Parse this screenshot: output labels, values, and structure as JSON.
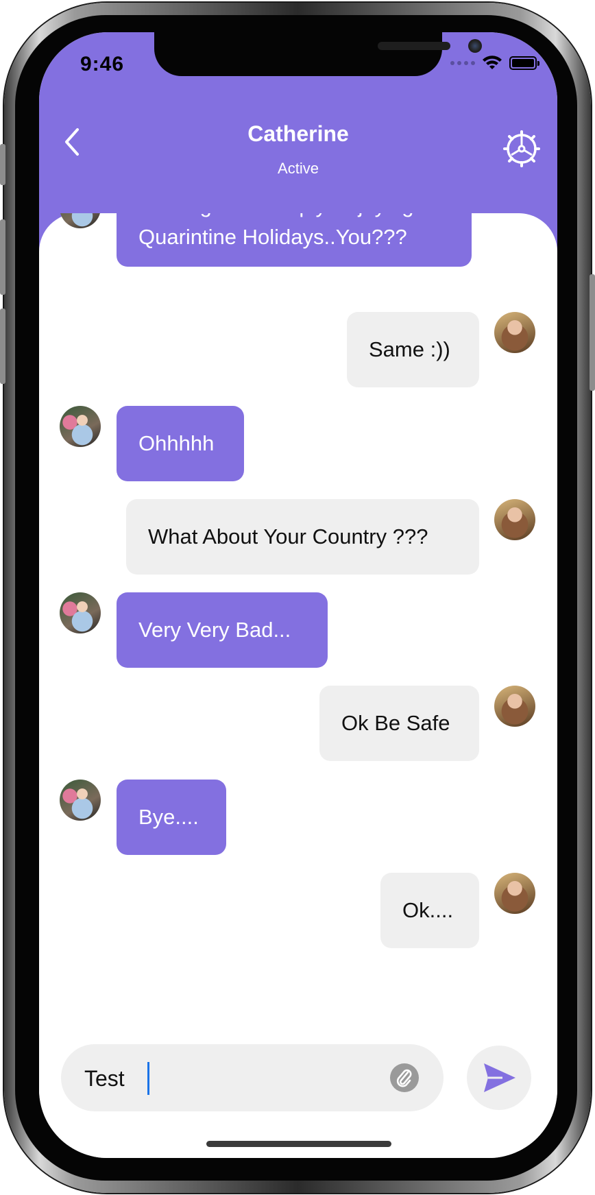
{
  "status_bar": {
    "time": "9:46"
  },
  "header": {
    "title": "Catherine",
    "subtitle": "Active"
  },
  "messages": [
    {
      "side": "in",
      "line1": "Nothing Just Simply Enjoying",
      "line2": "Quarintine Holidays..You???"
    },
    {
      "side": "out",
      "text": "Same :))"
    },
    {
      "side": "in",
      "text": "Ohhhhh"
    },
    {
      "side": "out",
      "text": "What About Your Country ???"
    },
    {
      "side": "in",
      "text": "Very Very Bad..."
    },
    {
      "side": "out",
      "text": "Ok Be Safe"
    },
    {
      "side": "in",
      "text": "Bye...."
    },
    {
      "side": "out",
      "text": "Ok...."
    }
  ],
  "composer": {
    "value": "Test"
  },
  "colors": {
    "accent": "#8370e0",
    "bubble_out": "#efefef"
  },
  "icons": {
    "back": "chevron-left-icon",
    "settings": "gear-icon",
    "attach": "paperclip-icon",
    "send": "send-icon"
  }
}
